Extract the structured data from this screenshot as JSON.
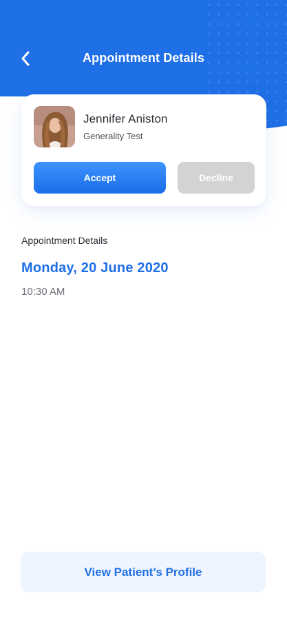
{
  "header": {
    "title": "Appointment Details",
    "back_icon": "chevron-left-icon"
  },
  "patient": {
    "name": "Jennifer Aniston",
    "subtitle": "Generality Test",
    "avatar": "avatar-photo"
  },
  "actions": {
    "accept_label": "Accept",
    "decline_label": "Decline"
  },
  "details": {
    "section_label": "Appointment Details",
    "date": "Monday, 20 June 2020",
    "time": "10:30 AM"
  },
  "footer": {
    "profile_button_label": "View Patient’s Profile"
  },
  "colors": {
    "primary": "#1f6fe6",
    "accept_gradient_top": "#3d94ff",
    "decline_bg": "#d3d3d3",
    "profile_button_bg": "#eef5fe"
  }
}
